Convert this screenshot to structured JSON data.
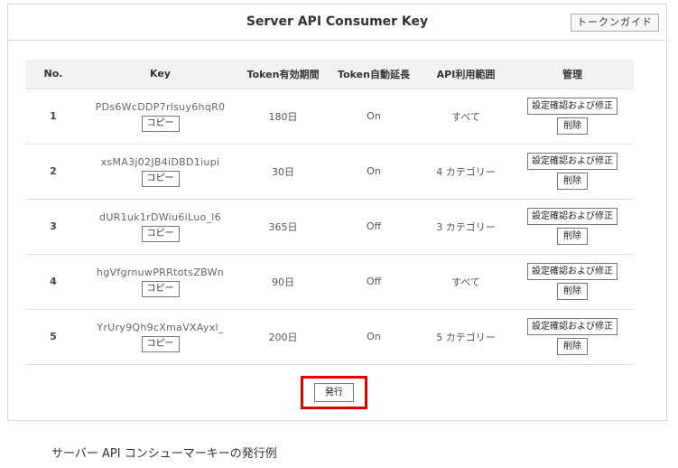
{
  "panel": {
    "title": "Server API Consumer Key",
    "guide_button": "トークンガイド"
  },
  "table": {
    "headers": {
      "no": "No.",
      "key": "Key",
      "expiry": "Token有効期間",
      "auto_extend": "Token自動延長",
      "scope": "API利用範囲",
      "manage": "管理"
    },
    "rows": [
      {
        "no": "1",
        "key": "PDs6WcDDP7rlsuy6hqR0",
        "copy": "コピー",
        "expiry": "180日",
        "auto_extend": "On",
        "scope": "すべて",
        "edit": "設定確認および修正",
        "delete": "削除"
      },
      {
        "no": "2",
        "key": "xsMA3j02JB4iDBD1iupi",
        "copy": "コピー",
        "expiry": "30日",
        "auto_extend": "On",
        "scope": "4 カテゴリー",
        "edit": "設定確認および修正",
        "delete": "削除"
      },
      {
        "no": "3",
        "key": "dUR1uk1rDWiu6iLuo_l6",
        "copy": "コピー",
        "expiry": "365日",
        "auto_extend": "Off",
        "scope": "3 カテゴリー",
        "edit": "設定確認および修正",
        "delete": "削除"
      },
      {
        "no": "4",
        "key": "hgVfgrnuwPRRtotsZBWn",
        "copy": "コピー",
        "expiry": "90日",
        "auto_extend": "Off",
        "scope": "すべて",
        "edit": "設定確認および修正",
        "delete": "削除"
      },
      {
        "no": "5",
        "key": "YrUry9Qh9cXmaVXAyxl_",
        "copy": "コピー",
        "expiry": "200日",
        "auto_extend": "On",
        "scope": "5 カテゴリー",
        "edit": "設定確認および修正",
        "delete": "削除"
      }
    ]
  },
  "issue_button": "発行",
  "highlight_color": "#e00000",
  "caption": "サーバー API コンシューマーキーの発行例"
}
